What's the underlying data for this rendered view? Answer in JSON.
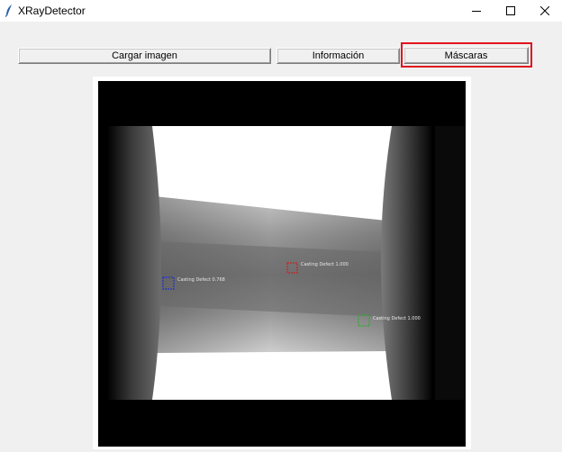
{
  "window": {
    "title": "XRayDetector"
  },
  "toolbar": {
    "load_image_label": "Cargar imagen",
    "info_label": "Información",
    "masks_label": "Máscaras"
  },
  "detections": [
    {
      "label": "Casting Defect 0.768",
      "color": "#2233cc"
    },
    {
      "label": "Casting Defect 1.000",
      "color": "#cc2222"
    },
    {
      "label": "Casting Defect 1.000",
      "color": "#33aa33"
    }
  ],
  "colors": {
    "highlight": "#e0131c"
  }
}
